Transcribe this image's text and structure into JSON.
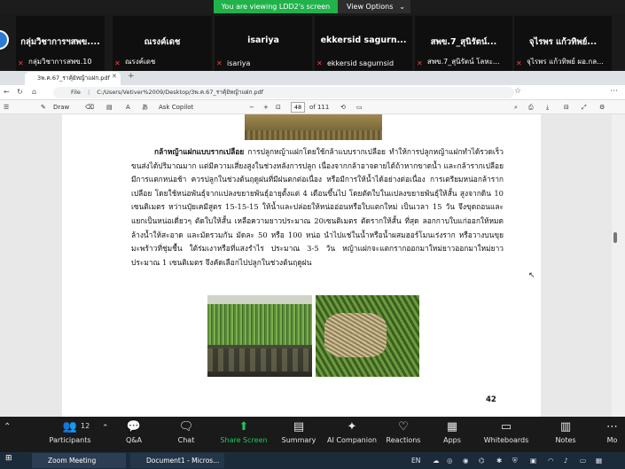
{
  "banner": {
    "viewing": "You are viewing LDD2's screen",
    "view_options": "View Options"
  },
  "participants": [
    {
      "name": "กลุ่มวิชาการฯสพข....",
      "label": "กลุ่มวิชาการสพข.10"
    },
    {
      "name": "ณรงค์เดช",
      "label": "ณรงค์เดช"
    },
    {
      "name": "isariya",
      "label": "isariya"
    },
    {
      "name": "ekkersid sagurn...",
      "label": "ekkersid sagurnsid"
    },
    {
      "name": "สพข.7_สุนิรัตน์...",
      "label": "สพข.7_สุนิรัตน์ โลหะ..."
    },
    {
      "name": "จุไรพร แก้วทิพย์...",
      "label": "จุไรพร แก้วทิพย์ ผอ.กล..."
    }
  ],
  "browser": {
    "tab_title": "3พ.ค.67_ราคุ้ยัหญ้าแฝก.pdf",
    "file_label": "File",
    "url": "C:/Users/Vetiver%2009/Desktop/3พ.ค.67_ราคุ้ยัหญ้าแฝก.pdf"
  },
  "pdf_toolbar": {
    "draw": "Draw",
    "ask_copilot": "Ask Copilot",
    "zoom_minus": "−",
    "zoom_plus": "+",
    "page_current": "48",
    "page_total": "of 111"
  },
  "document": {
    "heading": "กล้าหญ้าแฝกแบบรากเปลือย",
    "body": "การปลูกหญ้าแฝกโดยใช้กล้าแบบรากเปลือย ทำให้การปลูกหญ้าแฝกทำได้รวดเร็ว ขนส่งได้ปริมาณมาก แต่มีความเสี่ยงสูงในช่วงหลังการปลูก เนื่องจากกล้าอาจตายได้ถ้าหากขาดน้ำ และกล้ารากเปลือยมีการแตกหน่อช้า ควรปลูกในช่วงต้นฤดูฝนที่มีฝนตกต่อเนื่อง หรือมีการให้น้ำได้อย่างต่อเนื่อง การเตรียมหน่อกล้ารากเปลือย โดยใช้หน่อพันธุ์จากแปลงขยายพันธุ์อายุตั้งแต่ 4 เดือนขึ้นไป โดยตัดใบในแปลงขยายพันธุ์ให้สั้น สูงจากดิน 10 เซนติเมตร หว่านปุ๋ยเคมีสูตร 15-15-15 ให้น้ำและปล่อยให้หน่ออ่อนหรือใบแตกใหม่ เป็นเวลา 15 วัน จึงขุดถอนและแยกเป็นหน่อเดี่ยวๆ ตัดใบให้สั้น เหลือความยาวประมาณ 20เซนติเมตร ตัดรากให้สั้น ที่สุด ลอกกาบใบแก่ออกให้หมด ล้างน้ำให้สะอาด และมัดรวมกัน มัดละ 50 หรือ 100 หน่อ นำไปแช่ในน้ำหรือน้ำผสมฮอร์โมนเร่งราก หรือวางบนขุยมะพร้าวที่ชุ่มชื้น ใต้ร่มเงาหรือที่แสงรำไร ประมาณ 3-5 วัน หญ้าแฝกจะแตกรากออกมาใหม่ยาวออกมาใหม่ยาวประมาณ 1 เซนติเมตร จึงคัดเลือกไปปลูกในช่วงต้นฤดูฝน",
    "page_number": "42"
  },
  "zoom_toolbar": [
    {
      "label": "Participants",
      "icon": "participants-icon",
      "badge": "12"
    },
    {
      "label": "Q&A",
      "icon": "qa-icon"
    },
    {
      "label": "Chat",
      "icon": "chat-icon"
    },
    {
      "label": "Share Screen",
      "icon": "share-screen-icon"
    },
    {
      "label": "Summary",
      "icon": "summary-icon"
    },
    {
      "label": "AI Companion",
      "icon": "ai-companion-icon"
    },
    {
      "label": "Reactions",
      "icon": "reactions-icon"
    },
    {
      "label": "Apps",
      "icon": "apps-icon"
    },
    {
      "label": "Whiteboards",
      "icon": "whiteboards-icon"
    },
    {
      "label": "Notes",
      "icon": "notes-icon"
    },
    {
      "label": "Mo",
      "icon": "more-icon"
    }
  ],
  "taskbar": {
    "zoom_task": "Zoom Meeting",
    "word_task": "Document1 - Micros...",
    "lang": "EN"
  },
  "colors": {
    "share_green": "#22c55e",
    "banner_green": "#22b24c"
  }
}
